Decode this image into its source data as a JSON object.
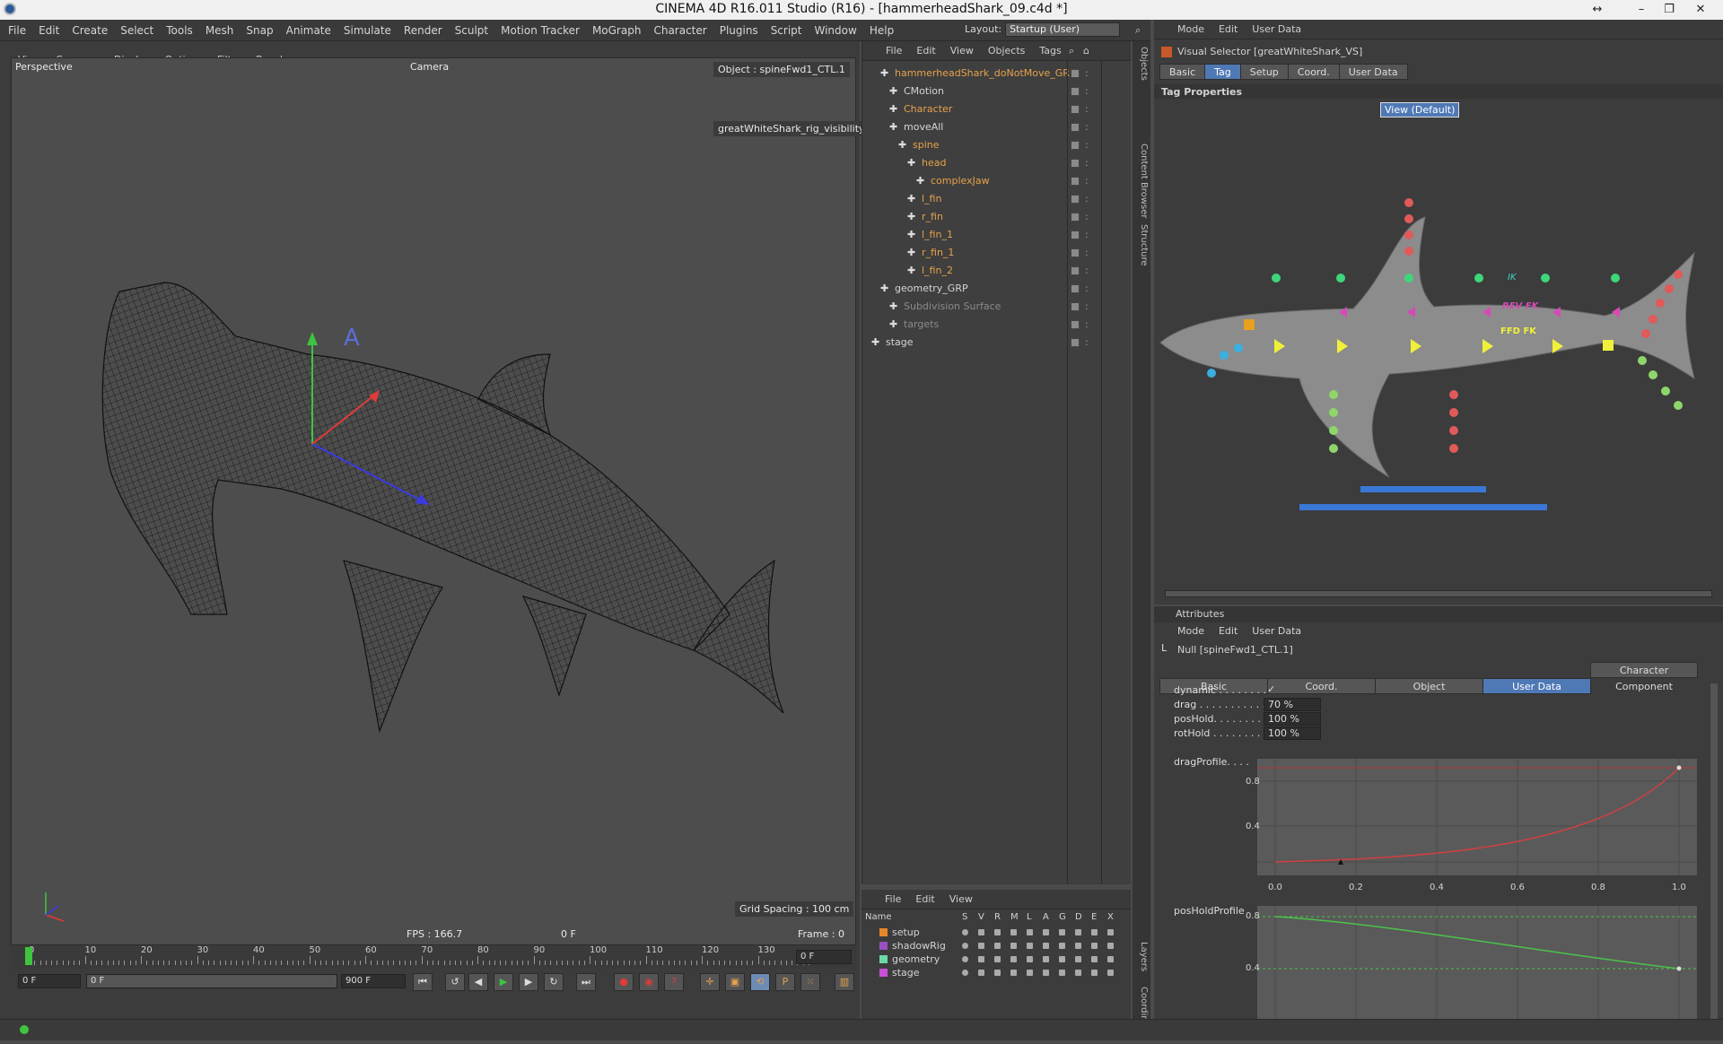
{
  "app": {
    "title": "CINEMA 4D R16.011 Studio (R16) - [hammerheadShark_09.c4d *]"
  },
  "menubar": {
    "items": [
      "File",
      "Edit",
      "Create",
      "Select",
      "Tools",
      "Mesh",
      "Snap",
      "Animate",
      "Simulate",
      "Render",
      "Sculpt",
      "Motion Tracker",
      "MoGraph",
      "Character",
      "Plugins",
      "Script",
      "Window",
      "Help"
    ],
    "layout_label": "Layout:",
    "layout_value": "Startup (User)"
  },
  "viewport": {
    "menu": [
      "View",
      "Cameras",
      "Display",
      "Options",
      "Filter",
      "Panel"
    ],
    "view_name": "Perspective",
    "camera_label": "Camera",
    "object_label": "Object : spineFwd1_CTL.1",
    "visibility_label": "greatWhiteShark_rig_visibility",
    "grid_spacing": "Grid Spacing : 100 cm",
    "fps": "FPS : 166.7",
    "frame_center": "0 F",
    "frame": "Frame : 0"
  },
  "timeline": {
    "ticks": [
      "0",
      "10",
      "20",
      "30",
      "40",
      "50",
      "60",
      "70",
      "80",
      "90",
      "100",
      "110",
      "120",
      "130"
    ],
    "current_field": "0 F",
    "start_field": "0 F",
    "slider_value": "0 F",
    "end_field": "900 F"
  },
  "object_manager": {
    "menu": [
      "File",
      "Edit",
      "View",
      "Objects",
      "Tags"
    ],
    "rows": [
      {
        "label": "hammerheadShark_doNotMove_GRP",
        "style": "orange"
      },
      {
        "label": "CMotion",
        "style": "normal"
      },
      {
        "label": "Character",
        "style": "orange"
      },
      {
        "label": "moveAll",
        "style": "normal"
      },
      {
        "label": "spine",
        "style": "orange"
      },
      {
        "label": "head",
        "style": "orange"
      },
      {
        "label": "complexJaw",
        "style": "orange"
      },
      {
        "label": "l_fin",
        "style": "orange"
      },
      {
        "label": "r_fin",
        "style": "orange"
      },
      {
        "label": "l_fin_1",
        "style": "orange"
      },
      {
        "label": "r_fin_1",
        "style": "orange"
      },
      {
        "label": "l_fin_2",
        "style": "orange"
      },
      {
        "label": "geometry_GRP",
        "style": "normal"
      },
      {
        "label": "Subdivision Surface",
        "style": "gray"
      },
      {
        "label": "targets",
        "style": "gray"
      },
      {
        "label": "stage",
        "style": "normal"
      }
    ]
  },
  "side_tabs": [
    "Objects",
    "Content Browser",
    "Structure",
    "Layers",
    "Coordinates"
  ],
  "visual_selector": {
    "menu": [
      "Mode",
      "Edit",
      "User Data"
    ],
    "title": "Visual Selector [greatWhiteShark_VS]",
    "tabs": [
      "Basic",
      "Tag",
      "Setup",
      "Coord.",
      "User Data"
    ],
    "active_tab": "Tag",
    "section": "Tag Properties",
    "view_button": "View (Default)",
    "labels": {
      "ik": "IK",
      "rev_fk": "REV FK",
      "ffd_fk": "FFD FK"
    }
  },
  "attributes": {
    "panel_title": "Attributes",
    "menu": [
      "Mode",
      "Edit",
      "User Data"
    ],
    "object": "Null [spineFwd1_CTL.1]",
    "tabs": [
      "Basic",
      "Coord.",
      "Object",
      "User Data",
      "Character Component"
    ],
    "active_tab": "User Data",
    "fields": [
      {
        "label": "dynamic . . . . . . . .",
        "value": "✓"
      },
      {
        "label": "drag . . . . . . . . . . .",
        "value": "70 %"
      },
      {
        "label": "posHold. . . . . . . .",
        "value": "100 %"
      },
      {
        "label": "rotHold . . . . . . . .",
        "value": "100 %"
      }
    ],
    "drag_profile_label": "dragProfile. . . .",
    "pos_hold_profile_label": "posHoldProfile",
    "graph_x_ticks": [
      "0.0",
      "0.2",
      "0.4",
      "0.6",
      "0.8",
      "1.0"
    ],
    "graph_y_ticks": [
      "0.8",
      "0.4"
    ],
    "graph2_y_ticks": [
      "0.8",
      "0.4"
    ]
  },
  "layers": {
    "menu": [
      "File",
      "Edit",
      "View"
    ],
    "columns": [
      "Name",
      "S",
      "V",
      "R",
      "M",
      "L",
      "A",
      "G",
      "D",
      "E",
      "X"
    ],
    "rows": [
      {
        "name": "setup",
        "color": "#e8872a"
      },
      {
        "name": "shadowRig",
        "color": "#9b4fc4"
      },
      {
        "name": "geometry",
        "color": "#6fd6a8"
      },
      {
        "name": "stage",
        "color": "#c84fd6"
      }
    ]
  }
}
